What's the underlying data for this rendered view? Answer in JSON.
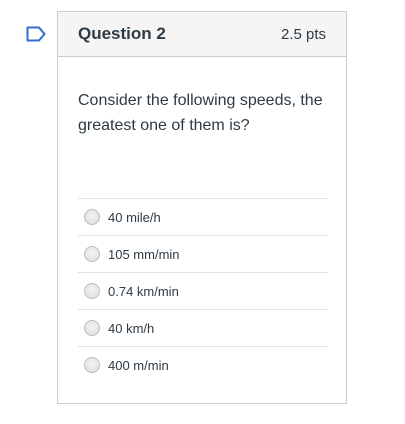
{
  "question": {
    "title": "Question 2",
    "points": "2.5 pts",
    "text": "Consider the following speeds, the greatest one of them is?"
  },
  "answers": [
    {
      "label": "40 mile/h"
    },
    {
      "label": "105 mm/min"
    },
    {
      "label": "0.74 km/min"
    },
    {
      "label": "40 km/h"
    },
    {
      "label": "400 m/min"
    }
  ],
  "icons": {
    "flag": "flag-bookmark-icon"
  },
  "colors": {
    "text": "#2d3b45",
    "border": "#c7cdd1",
    "header_bg": "#f5f5f5",
    "flag": "#2d6ed1"
  }
}
